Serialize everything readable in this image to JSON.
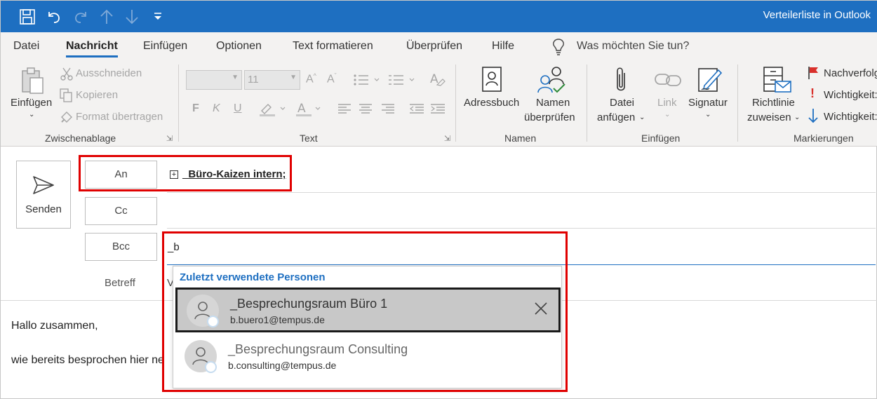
{
  "window": {
    "title": "Verteilerliste in Outlook"
  },
  "qat": {
    "save_icon": "save-icon",
    "undo_icon": "undo-icon",
    "redo_icon": "redo-icon",
    "up_icon": "arrow-up-icon",
    "down_icon": "arrow-down-icon",
    "customize_icon": "customize-qat-icon"
  },
  "tabs": [
    "Datei",
    "Nachricht",
    "Einfügen",
    "Optionen",
    "Text formatieren",
    "Überprüfen",
    "Hilfe"
  ],
  "active_tab": "Nachricht",
  "tell_me": {
    "placeholder": "Was möchten Sie tun?"
  },
  "ribbon": {
    "clipboard": {
      "label": "Zwischenablage",
      "paste": "Einfügen",
      "cut": "Ausschneiden",
      "copy": "Kopieren",
      "format_painter": "Format übertragen"
    },
    "text": {
      "label": "Text",
      "font_size": "11",
      "bold": "F",
      "italic": "K",
      "underline": "U"
    },
    "names": {
      "label": "Namen",
      "address_book": "Adressbuch",
      "check_names_line1": "Namen",
      "check_names_line2": "überprüfen"
    },
    "insert": {
      "label": "Einfügen",
      "attach_line1": "Datei",
      "attach_line2": "anfügen",
      "link": "Link",
      "signature": "Signatur"
    },
    "tags": {
      "label": "Markierungen",
      "policy_line1": "Richtlinie",
      "policy_line2": "zuweisen",
      "follow_up": "Nachverfolgung",
      "high_importance": "Wichtigkeit: hoch",
      "low_importance": "Wichtigkeit: niedrig"
    }
  },
  "compose": {
    "send": "Senden",
    "to": "An",
    "cc": "Cc",
    "bcc": "Bcc",
    "to_recipient": "_Büro-Kaizen intern;",
    "bcc_input": "_b",
    "subject_label": "Betreff",
    "subject_partial": "V"
  },
  "autocomplete": {
    "header": "Zuletzt verwendete Personen",
    "items": [
      {
        "name": "_Besprechungsraum Büro 1",
        "email": "b.buero1@tempus.de",
        "selected": true
      },
      {
        "name": "_Besprechungsraum Consulting",
        "email": "b.consulting@tempus.de",
        "selected": false
      }
    ]
  },
  "body": {
    "line1": "Hallo zusammen,",
    "line2": "wie bereits besprochen hier ne"
  },
  "colors": {
    "accent": "#1e6fc1",
    "highlight_box": "#e00000"
  }
}
